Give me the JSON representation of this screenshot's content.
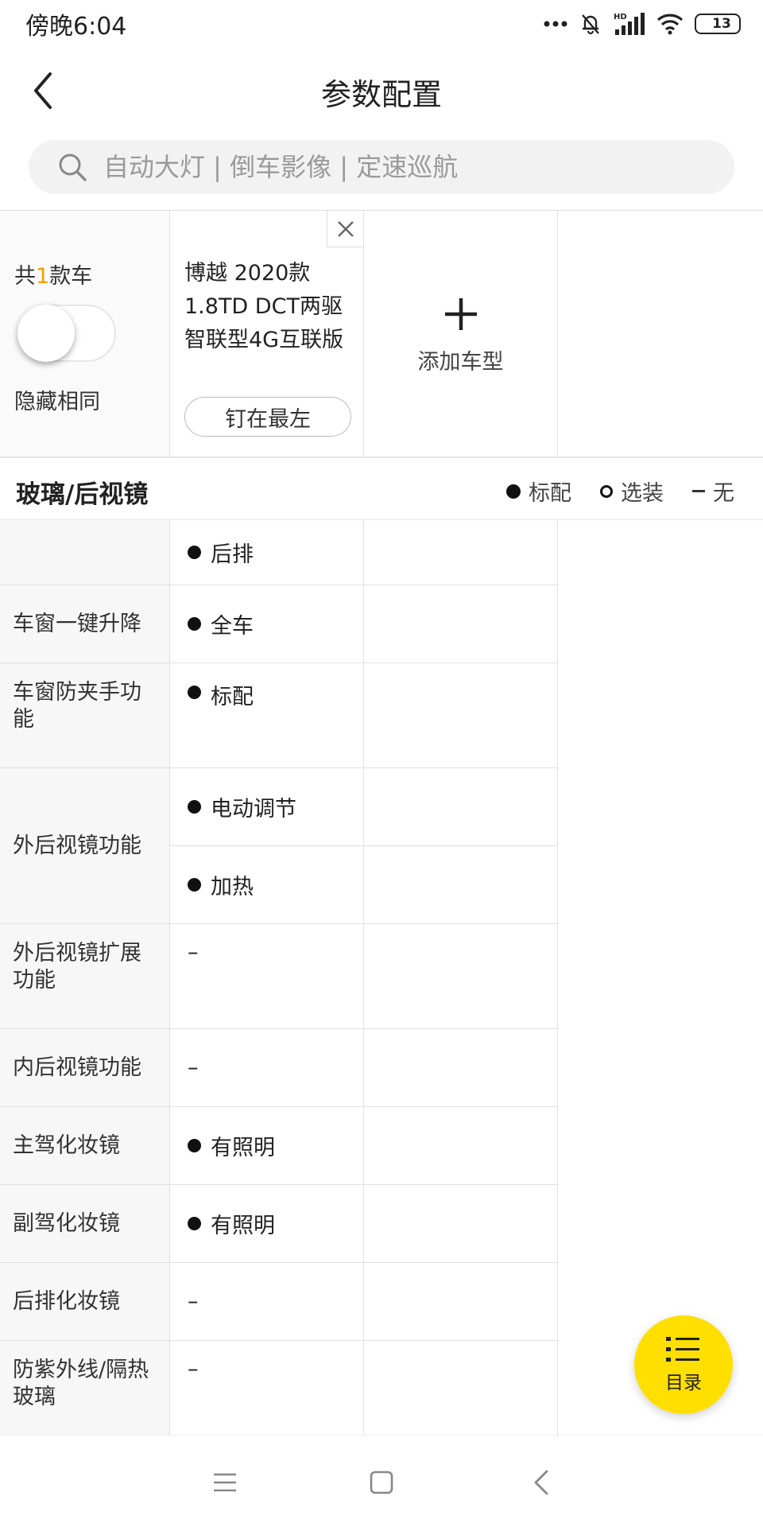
{
  "status_bar": {
    "time": "傍晚6:04",
    "network": "HD",
    "battery": "13"
  },
  "header": {
    "title": "参数配置"
  },
  "search": {
    "placeholder": "自动大灯 | 倒车影像 | 定速巡航"
  },
  "compare": {
    "count_prefix": "共",
    "count": "1",
    "count_suffix": "款车",
    "hide_same_label": "隐藏相同",
    "hide_same_enabled": false,
    "car": {
      "name": "博越 2020款 1.8TD DCT两驱智联型4G互联版",
      "pin_label": "钉在最左"
    },
    "add_label": "添加车型"
  },
  "section": {
    "title": "玻璃/后视镜",
    "legend": {
      "standard": "标配",
      "optional": "选装",
      "none": "无"
    }
  },
  "rows": [
    {
      "label": "",
      "values": [
        "后排"
      ]
    },
    {
      "label": "车窗一键升降",
      "values": [
        "全车"
      ]
    },
    {
      "label": "车窗防夹手功能",
      "values": [
        "标配"
      ]
    },
    {
      "label": "外后视镜功能",
      "values": [
        "电动调节",
        "加热"
      ]
    },
    {
      "label": "外后视镜扩展功能",
      "values": [
        "–"
      ]
    },
    {
      "label": "内后视镜功能",
      "values": [
        "–"
      ]
    },
    {
      "label": "主驾化妆镜",
      "values": [
        "有照明"
      ]
    },
    {
      "label": "副驾化妆镜",
      "values": [
        "有照明"
      ]
    },
    {
      "label": "后排化妆镜",
      "values": [
        "–"
      ]
    },
    {
      "label": "防紫外线/隔热玻璃",
      "values": [
        "–"
      ]
    }
  ],
  "fab": {
    "label": "目录"
  },
  "icons": {
    "back": "chevron-left-icon",
    "search": "search-icon",
    "close": "close-icon",
    "add": "plus-icon",
    "catalog": "list-icon",
    "nav_menu": "menu-icon",
    "nav_home": "square-icon",
    "nav_back": "chevron-left-icon"
  }
}
